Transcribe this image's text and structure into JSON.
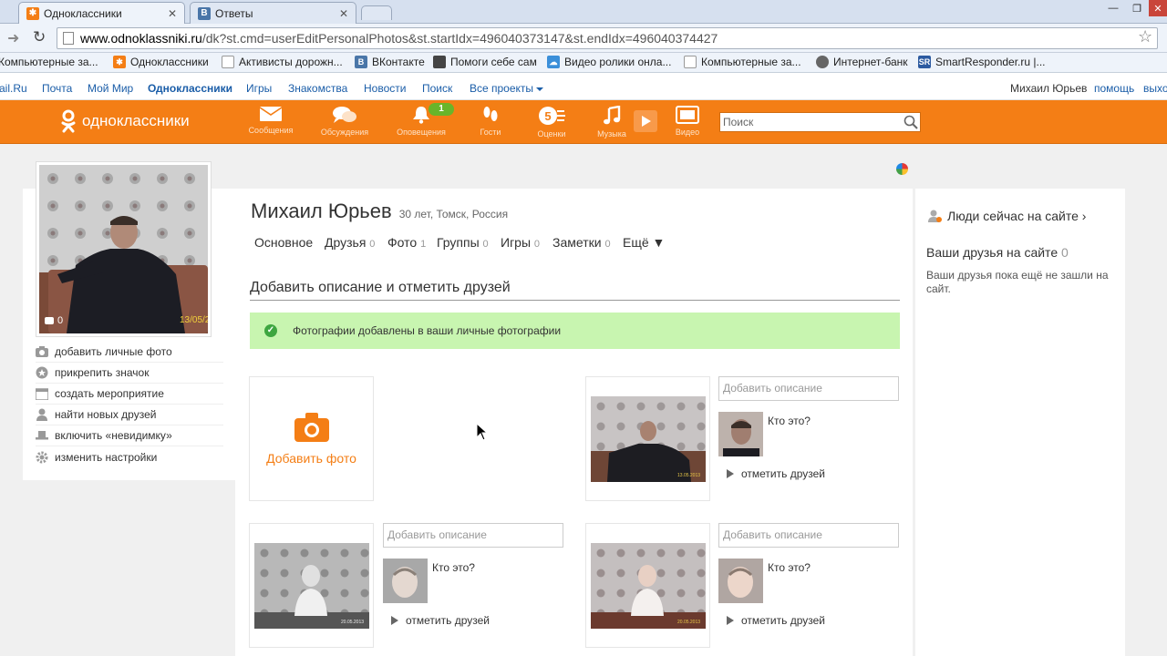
{
  "browser": {
    "tabs": [
      {
        "label": "Одноклассники",
        "icon": "ok-favicon",
        "active": true
      },
      {
        "label": "Ответы",
        "icon": "vk-favicon",
        "active": false
      }
    ],
    "url_host": "www.odnoklassniki.ru",
    "url_path": "/dk?st.cmd=userEditPersonalPhotos&st.startIdx=496040373147&st.endIdx=496040374427",
    "bookmarks": [
      {
        "label": "Компьютерные за...",
        "icon": "page-icon"
      },
      {
        "label": "Одноклассники",
        "icon": "ok-favicon"
      },
      {
        "label": "Активисты дорожн...",
        "icon": "page-icon"
      },
      {
        "label": "ВКонтакте",
        "icon": "vk-favicon"
      },
      {
        "label": "Помоги себе сам",
        "icon": "movie-icon"
      },
      {
        "label": "Видео ролики онла...",
        "icon": "cloud-icon"
      },
      {
        "label": "Компьютерные за...",
        "icon": "page-icon"
      },
      {
        "label": "Интернет-банк",
        "icon": "globe-icon"
      },
      {
        "label": "SmartResponder.ru |...",
        "icon": "sr-icon"
      }
    ]
  },
  "mailbar": {
    "links": [
      "ail.Ru",
      "Почта",
      "Мой Мир",
      "Одноклассники",
      "Игры",
      "Знакомства",
      "Новости",
      "Поиск",
      "Все проекты"
    ],
    "user": "Михаил Юрьев",
    "help": "помощь",
    "exit": "выхо"
  },
  "toolbar": {
    "logo": "одноклассники",
    "items": [
      {
        "label": "Сообщения",
        "icon": "envelope-icon"
      },
      {
        "label": "Обсуждения",
        "icon": "chat-bubbles-icon"
      },
      {
        "label": "Оповещения",
        "icon": "bell-icon",
        "badge": "1"
      },
      {
        "label": "Гости",
        "icon": "footprints-icon"
      },
      {
        "label": "Оценки",
        "icon": "rating-icon"
      },
      {
        "label": "Музыка",
        "icon": "music-note-icon"
      },
      {
        "label": "Видео",
        "icon": "video-icon"
      }
    ],
    "search_placeholder": "Поиск"
  },
  "profile": {
    "name": "Михаил Юрьев",
    "meta": "30 лет, Томск, Россия",
    "avatar_comments": "0",
    "avatar_date": "13/05/2",
    "tabs": [
      {
        "label": "Основное",
        "count": ""
      },
      {
        "label": "Друзья",
        "count": "0"
      },
      {
        "label": "Фото",
        "count": "1"
      },
      {
        "label": "Группы",
        "count": "0"
      },
      {
        "label": "Игры",
        "count": "0"
      },
      {
        "label": "Заметки",
        "count": "0"
      },
      {
        "label": "Ещё ▼",
        "count": ""
      }
    ]
  },
  "sidebar": {
    "items": [
      {
        "label": "добавить личные фото",
        "icon": "camera-icon"
      },
      {
        "label": "прикрепить значок",
        "icon": "badge-icon"
      },
      {
        "label": "создать мероприятие",
        "icon": "calendar-icon"
      },
      {
        "label": "найти новых друзей",
        "icon": "person-icon"
      },
      {
        "label": "включить «невидимку»",
        "icon": "invisible-hat-icon"
      },
      {
        "label": "изменить настройки",
        "icon": "gear-icon"
      }
    ]
  },
  "main": {
    "section_title": "Добавить описание и отметить друзей",
    "success_message": "Фотографии добавлены в ваши личные фотографии",
    "add_photo_label": "Добавить фото",
    "description_placeholder": "Добавить описание",
    "who_label": "Кто это?",
    "tag_friends_label": "отметить друзей"
  },
  "right": {
    "people_online": "Люди сейчас на сайте ›",
    "friends_online": "Ваши друзья на сайте",
    "friends_count": "0",
    "friends_note": "Ваши друзья пока ещё не зашли на сайт."
  },
  "colors": {
    "brand_orange": "#f47e15",
    "success_bg": "#c8f5b0",
    "success_icon": "#3ea640",
    "link_blue": "#1a5da8"
  }
}
